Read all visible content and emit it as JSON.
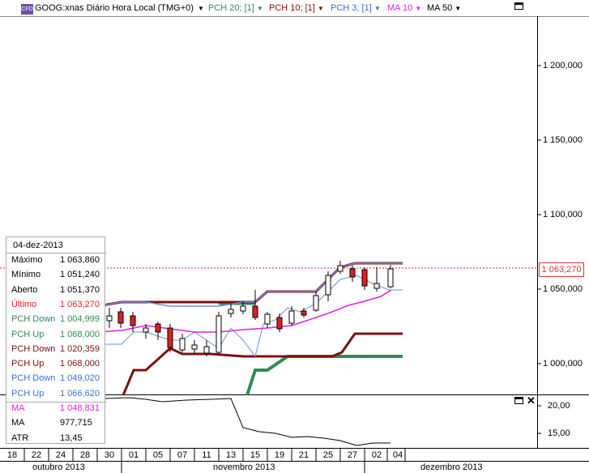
{
  "header": {
    "cfd_badge": "CFD",
    "symbol": "GOOG:xnas Diário Hora Local (TMG+0)",
    "indicators": [
      {
        "label": "PCH 20; [1]",
        "color": "#2e8b57"
      },
      {
        "label": "PCH 10; [1]",
        "color": "#7a1010"
      },
      {
        "label": "PCH 3; [1]",
        "color": "#3a6fd8"
      },
      {
        "label": "MA 10",
        "color": "#e020e0"
      },
      {
        "label": "MA 50",
        "color": "#000000"
      }
    ]
  },
  "price_axis": {
    "labels": [
      "1 200,000",
      "1 150,000",
      "1 100,000",
      "1 050,000",
      "1 000,000"
    ],
    "last_price_label": "1 063,270"
  },
  "sub_axis": {
    "labels": [
      "20,00",
      "15,00"
    ]
  },
  "time_axis": {
    "days": [
      "18",
      "22",
      "24",
      "28",
      "30",
      "01",
      "05",
      "07",
      "11",
      "13",
      "15",
      "19",
      "21",
      "25",
      "27",
      "02",
      "04"
    ],
    "months": [
      "outubro 2013",
      "novembro 2013",
      "dezembro 2013"
    ]
  },
  "infobox": {
    "date": "04-dez-2013",
    "rows": [
      {
        "label": "Máximo",
        "value": "1 063,860",
        "color": "#000000"
      },
      {
        "label": "Mínimo",
        "value": "1 051,240",
        "color": "#000000"
      },
      {
        "label": "Aberto",
        "value": "1 051,370",
        "color": "#000000"
      },
      {
        "label": "Último",
        "value": "1 063,270",
        "color": "#e02020"
      },
      {
        "label": "PCH Down",
        "value": "1 004,999",
        "color": "#2e8b57"
      },
      {
        "label": "PCH Up",
        "value": "1 068,000",
        "color": "#2e8b57"
      },
      {
        "label": "PCH Down",
        "value": "1 020,359",
        "color": "#7a1010"
      },
      {
        "label": "PCH Up",
        "value": "1 068,000",
        "color": "#7a1010"
      },
      {
        "label": "PCH Down",
        "value": "1 049,020",
        "color": "#3a6fd8"
      },
      {
        "label": "PCH Up",
        "value": "1 066,620",
        "color": "#3a6fd8"
      },
      {
        "label": "MA",
        "value": "1 048,831",
        "color": "#e020e0"
      },
      {
        "label": "MA",
        "value": "977,715",
        "color": "#000000"
      },
      {
        "label": "ATR",
        "value": "13,45",
        "color": "#000000"
      }
    ]
  },
  "colors": {
    "up_candle": "#ffffff",
    "down_candle": "#e02020",
    "ma10": "#e020e0",
    "pch3": "#6a8fe0",
    "pch10": "#7a1010",
    "pch20": "#2e8b57",
    "last_line": "#e02020"
  }
}
